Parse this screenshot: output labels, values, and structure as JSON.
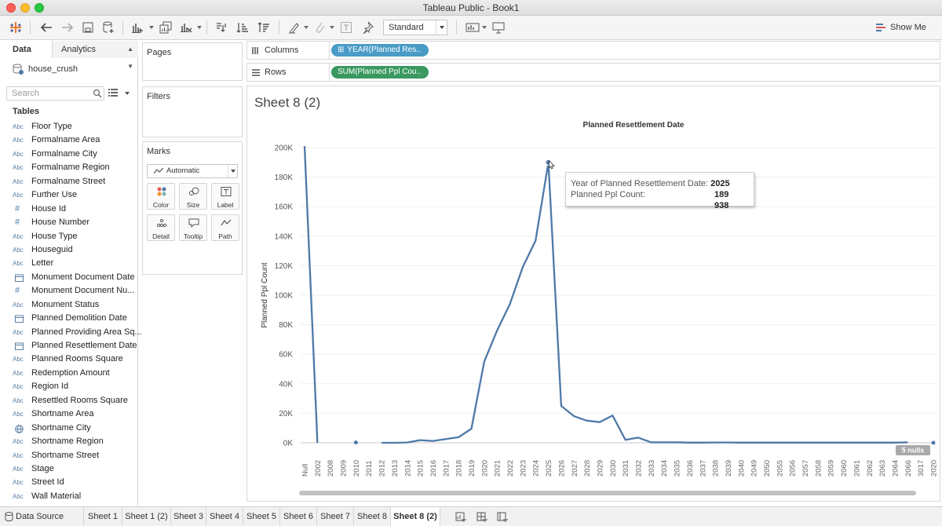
{
  "window": {
    "title": "Tableau Public - Book1"
  },
  "toolbar": {
    "view_size": "Standard",
    "show_me": "Show Me"
  },
  "data_pane": {
    "tab_data": "Data",
    "tab_analytics": "Analytics",
    "datasource": "house_crush",
    "search_placeholder": "Search",
    "tables_heading": "Tables",
    "fields": [
      {
        "name": "Floor Type",
        "type": "Abc"
      },
      {
        "name": "Formalname Area",
        "type": "Abc"
      },
      {
        "name": "Formalname City",
        "type": "Abc"
      },
      {
        "name": "Formalname Region",
        "type": "Abc"
      },
      {
        "name": "Formalname Street",
        "type": "Abc"
      },
      {
        "name": "Further Use",
        "type": "Abc"
      },
      {
        "name": "House Id",
        "type": "#"
      },
      {
        "name": "House Number",
        "type": "#"
      },
      {
        "name": "House Type",
        "type": "Abc"
      },
      {
        "name": "Houseguid",
        "type": "Abc"
      },
      {
        "name": "Letter",
        "type": "Abc"
      },
      {
        "name": "Monument Document Date",
        "type": "date"
      },
      {
        "name": "Monument Document Nu...",
        "type": "#"
      },
      {
        "name": "Monument Status",
        "type": "Abc"
      },
      {
        "name": "Planned Demolition Date",
        "type": "date"
      },
      {
        "name": "Planned Providing Area Sq...",
        "type": "Abc"
      },
      {
        "name": "Planned Resettlement Date",
        "type": "date"
      },
      {
        "name": "Planned Rooms Square",
        "type": "Abc"
      },
      {
        "name": "Redemption Amount",
        "type": "Abc"
      },
      {
        "name": "Region Id",
        "type": "Abc"
      },
      {
        "name": "Resettled Rooms Square",
        "type": "Abc"
      },
      {
        "name": "Shortname Area",
        "type": "Abc"
      },
      {
        "name": "Shortname City",
        "type": "geo"
      },
      {
        "name": "Shortname Region",
        "type": "Abc"
      },
      {
        "name": "Shortname Street",
        "type": "Abc"
      },
      {
        "name": "Stage",
        "type": "Abc"
      },
      {
        "name": "Street Id",
        "type": "Abc"
      },
      {
        "name": "Wall Material",
        "type": "Abc"
      }
    ]
  },
  "cards": {
    "pages": "Pages",
    "filters": "Filters",
    "marks": "Marks",
    "mark_type": "Automatic",
    "mark_buttons": [
      "Color",
      "Size",
      "Label",
      "Detail",
      "Tooltip",
      "Path"
    ]
  },
  "shelves": {
    "columns_label": "Columns",
    "columns_pill": "YEAR(Planned Res..",
    "rows_label": "Rows",
    "rows_pill": "SUM(Planned Ppl Cou.."
  },
  "sheet": {
    "title": "Sheet 8 (2)",
    "nulls_badge": "5 nulls"
  },
  "tooltip": {
    "label1": "Year of Planned Resettlement Date:",
    "value1": "2025",
    "label2": "Planned Ppl Count:",
    "value2": "189 938"
  },
  "bottom_tabs": {
    "data_source": "Data Source",
    "sheets": [
      "Sheet 1",
      "Sheet 1 (2)",
      "Sheet 3",
      "Sheet 4",
      "Sheet 5",
      "Sheet 6",
      "Sheet 7",
      "Sheet 8",
      "Sheet 8 (2)"
    ],
    "active": "Sheet 8 (2)"
  },
  "colors": {
    "line": "#4e79a7",
    "columns_pill": "#4a9cc6",
    "rows_pill": "#3a9960"
  },
  "chart_data": {
    "type": "line",
    "title": "Planned Resettlement Date",
    "xlabel": "",
    "ylabel": "Planned Ppl Count",
    "ylim": [
      0,
      200000
    ],
    "y_ticks": [
      "0K",
      "20K",
      "40K",
      "60K",
      "80K",
      "100K",
      "120K",
      "140K",
      "160K",
      "180K",
      "200K"
    ],
    "grid": true,
    "categories": [
      "Null",
      "2002",
      "2008",
      "2009",
      "2010",
      "2011",
      "2012",
      "2013",
      "2014",
      "2015",
      "2016",
      "2017",
      "2018",
      "2019",
      "2020",
      "2021",
      "2022",
      "2023",
      "2024",
      "2025",
      "2026",
      "2027",
      "2028",
      "2029",
      "2030",
      "2031",
      "2032",
      "2033",
      "2034",
      "2035",
      "2036",
      "2037",
      "2038",
      "2039",
      "2040",
      "2049",
      "2050",
      "2055",
      "2056",
      "2057",
      "2058",
      "2059",
      "2060",
      "2061",
      "2062",
      "2063",
      "2064",
      "2066",
      "3017",
      "2020"
    ],
    "values": [
      201000,
      0,
      null,
      null,
      200,
      null,
      0,
      0,
      200,
      1800,
      1200,
      2500,
      3800,
      9500,
      55000,
      76000,
      94000,
      119000,
      137000,
      189938,
      25000,
      18000,
      15000,
      14000,
      18500,
      2000,
      3500,
      300,
      300,
      300,
      100,
      100,
      200,
      200,
      100,
      100,
      100,
      100,
      100,
      100,
      100,
      100,
      100,
      100,
      100,
      100,
      100,
      300,
      null,
      0
    ]
  }
}
